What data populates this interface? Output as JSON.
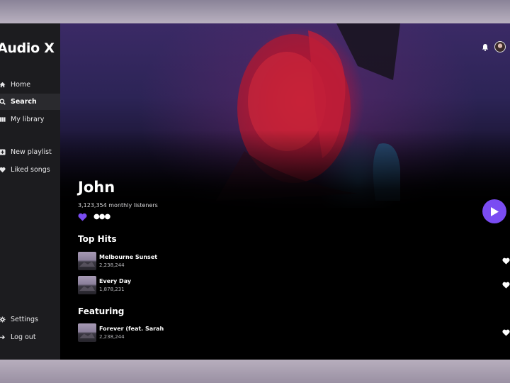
{
  "app": {
    "logo": "Audio X"
  },
  "sidebar": {
    "items": [
      {
        "label": "Home",
        "icon": "home-icon"
      },
      {
        "label": "Search",
        "icon": "search-icon",
        "active": true
      },
      {
        "label": "My library",
        "icon": "library-icon"
      },
      {
        "label": "New playlist",
        "icon": "add-playlist-icon"
      },
      {
        "label": "Liked songs",
        "icon": "heart-icon"
      },
      {
        "label": "Settings",
        "icon": "gear-icon"
      },
      {
        "label": "Log out",
        "icon": "logout-icon"
      }
    ]
  },
  "header": {
    "icons": [
      "bell-icon",
      "avatar"
    ]
  },
  "artist": {
    "name": "John",
    "listeners": "3,123,354 monthly listeners"
  },
  "sections": {
    "top_hits": {
      "title": "Top Hits",
      "tracks": [
        {
          "title": "Melbourne Sunset",
          "plays": "2,238,244"
        },
        {
          "title": "Every Day",
          "plays": "1,878,231"
        }
      ]
    },
    "featuring": {
      "title": "Featuring",
      "tracks": [
        {
          "title": "Forever (feat. Sarah",
          "plays": "2,238,244"
        }
      ]
    }
  },
  "colors": {
    "accent": "#7a4cf2",
    "sidebar": "#1c1c1f",
    "background": "#000000"
  }
}
